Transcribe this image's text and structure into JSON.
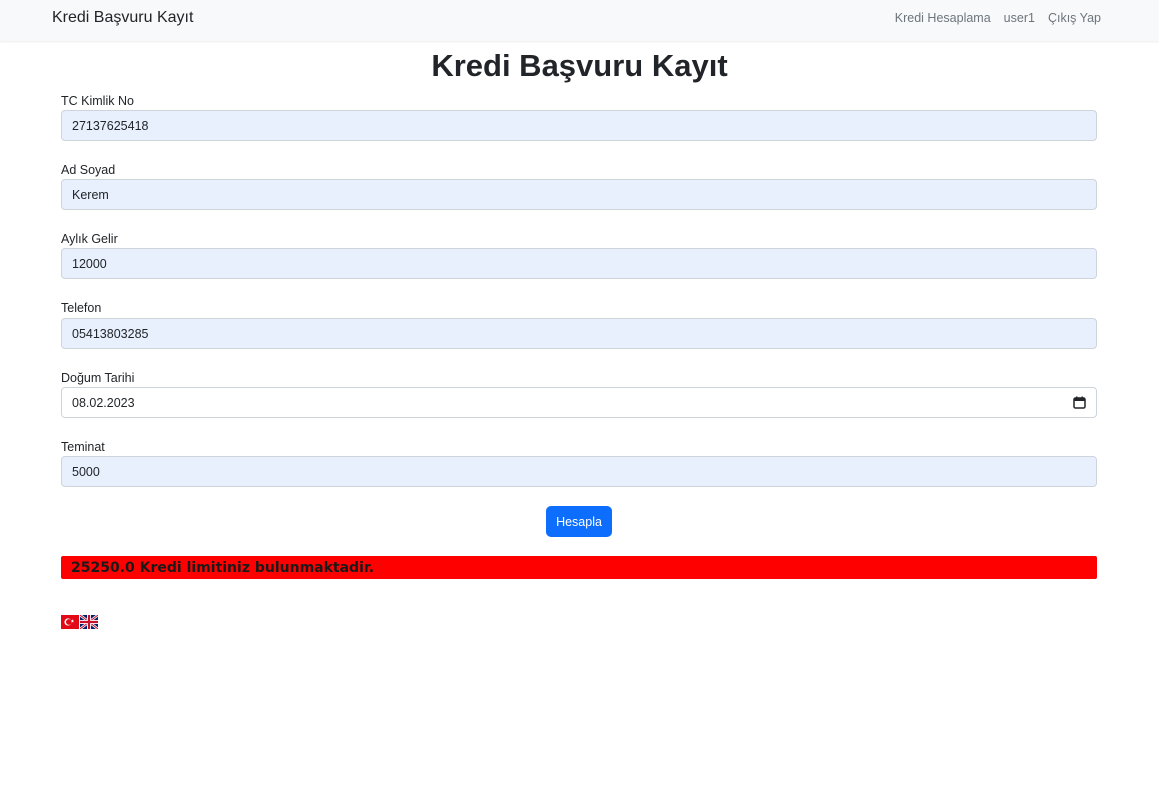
{
  "navbar": {
    "brand": "Kredi Başvuru Kayıt",
    "links": [
      "Kredi Hesaplama",
      "user1",
      "Çıkış Yap"
    ]
  },
  "page": {
    "title": "Kredi Başvuru Kayıt"
  },
  "form": {
    "tc": {
      "label": "TC Kimlik No",
      "value": "27137625418"
    },
    "name": {
      "label": "Ad Soyad",
      "value": "Kerem"
    },
    "income": {
      "label": "Aylık Gelir",
      "value": "12000"
    },
    "phone": {
      "label": "Telefon",
      "value": "05413803285"
    },
    "birthdate": {
      "label": "Doğum Tarihi",
      "value": "08.02.2023",
      "icon": "calendar-icon"
    },
    "collateral": {
      "label": "Teminat",
      "value": "5000"
    },
    "submit_label": "Hesapla"
  },
  "result": {
    "message": "25250.0 Kredi limitiniz bulunmaktadir."
  },
  "languages": {
    "tr_icon": "turkey-flag-icon",
    "en_icon": "uk-flag-icon"
  },
  "colors": {
    "primary": "#0d6efd",
    "alert": "#ff0000",
    "autofill": "#e8f0fe",
    "navbar_bg": "#f8f9fa"
  }
}
